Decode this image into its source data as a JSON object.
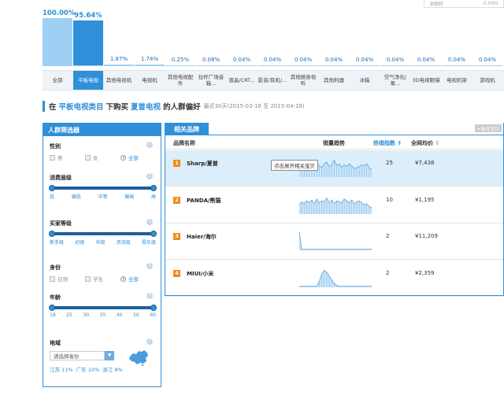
{
  "top_right": {
    "label": "油烟机",
    "value": "0.04%"
  },
  "bars": [
    {
      "pct": "100.00%",
      "ratio": 1.0,
      "active": false
    },
    {
      "pct": "95.64%",
      "ratio": 0.9564,
      "active": true
    },
    {
      "pct": "1.87%",
      "ratio": 0.0187,
      "active": false
    },
    {
      "pct": "1.74%",
      "ratio": 0.0174,
      "active": false
    },
    {
      "pct": "0.25%",
      "ratio": 0.0025,
      "active": false
    },
    {
      "pct": "0.08%",
      "ratio": 0.0008,
      "active": false
    },
    {
      "pct": "0.04%",
      "ratio": 0.0004,
      "active": false
    },
    {
      "pct": "0.04%",
      "ratio": 0.0004,
      "active": false
    },
    {
      "pct": "0.04%",
      "ratio": 0.0004,
      "active": false
    },
    {
      "pct": "0.04%",
      "ratio": 0.0004,
      "active": false
    },
    {
      "pct": "0.04%",
      "ratio": 0.0004,
      "active": false
    },
    {
      "pct": "0.04%",
      "ratio": 0.0004,
      "active": false
    },
    {
      "pct": "0.04%",
      "ratio": 0.0004,
      "active": false
    },
    {
      "pct": "0.04%",
      "ratio": 0.0004,
      "active": false
    },
    {
      "pct": "0.04%",
      "ratio": 0.0004,
      "active": false
    }
  ],
  "categories": [
    "全部",
    "平板电视",
    "其他电视机",
    "电视机",
    "其他电视配件",
    "拉杆广场音箱...",
    "液晶/CRT...",
    "影音/耳机/...",
    "其他随身视听",
    "其他利器",
    "冰箱",
    "空气净化/氧...",
    "3D电视眼镜",
    "电视机架",
    "游戏机"
  ],
  "heading": {
    "part1": "在",
    "category": "平板电视类目",
    "part2": "下购买",
    "brand": "夏普电视",
    "part3": "的人群偏好",
    "range": "最近30天(2015-03-18 至 2015-04-16)"
  },
  "filter": {
    "title": "人群筛选器",
    "gender": {
      "title": "性别",
      "options": [
        "男",
        "女",
        "全部"
      ],
      "selected": "全部"
    },
    "consumption": {
      "title": "消费层级",
      "ticks": [
        "低",
        "偏低",
        "中等",
        "偏高",
        "高"
      ]
    },
    "buyer_level": {
      "title": "买家等级",
      "ticks": [
        "新手级",
        "初级",
        "中级",
        "资深级",
        "骨灰级"
      ]
    },
    "identity": {
      "title": "身份",
      "options": [
        "白领",
        "学生",
        "全部"
      ],
      "selected": "全部"
    },
    "age": {
      "title": "年龄",
      "ticks": [
        "18",
        "25",
        "30",
        "35",
        "40",
        "50",
        "60"
      ]
    },
    "region": {
      "title": "地域",
      "placeholder": "请选择省份",
      "stats": [
        "江苏 11%",
        "广东 10%",
        "浙江 8%"
      ]
    }
  },
  "brands": {
    "tab": "相关品牌",
    "unfold": "+展开宝贝",
    "columns": {
      "name": "品牌名称",
      "trend": "销量趋势",
      "hot": "热销指数",
      "price": "全网均价"
    },
    "tooltip": "点击展开相关宝贝",
    "rows": [
      {
        "rank": "1",
        "name": "Sharp/夏普",
        "hot": "25",
        "price": "¥7,438",
        "trend": [
          0.55,
          0.6,
          0.45,
          0.7,
          0.5,
          0.65,
          0.55,
          0.75,
          0.6,
          0.5,
          0.7,
          0.8,
          0.55,
          0.65,
          0.9,
          0.6,
          0.7,
          0.5,
          0.65,
          0.55,
          0.7,
          0.6,
          0.45,
          0.5,
          0.55,
          0.65,
          0.6,
          0.7,
          0.5,
          0.4
        ]
      },
      {
        "rank": "2",
        "name": "PANDA/熊猫",
        "hot": "10",
        "price": "¥1,195",
        "trend": [
          0.5,
          0.65,
          0.55,
          0.7,
          0.6,
          0.75,
          0.55,
          0.8,
          0.6,
          0.7,
          0.65,
          0.85,
          0.6,
          0.75,
          0.55,
          0.7,
          0.65,
          0.6,
          0.8,
          0.7,
          0.6,
          0.75,
          0.55,
          0.65,
          0.7,
          0.6,
          0.5,
          0.55,
          0.4,
          0.35
        ]
      },
      {
        "rank": "3",
        "name": "Haier/海尔",
        "hot": "2",
        "price": "¥11,209",
        "trend": [
          1.0,
          0.05,
          0.05,
          0.05,
          0.05,
          0.05,
          0.05,
          0.05,
          0.05,
          0.05,
          0.05,
          0.05,
          0.05,
          0.05,
          0.05,
          0.05,
          0.05,
          0.05,
          0.05,
          0.05,
          0.05,
          0.05,
          0.05,
          0.05,
          0.05,
          0.05,
          0.05,
          0.05,
          0.05,
          0.05
        ]
      },
      {
        "rank": "4",
        "name": "MIUI/小米",
        "hot": "2",
        "price": "¥2,359",
        "trend": [
          0.05,
          0.05,
          0.05,
          0.05,
          0.05,
          0.05,
          0.05,
          0.05,
          0.3,
          0.7,
          0.9,
          0.8,
          0.6,
          0.4,
          0.2,
          0.1,
          0.05,
          0.05,
          0.05,
          0.05,
          0.05,
          0.05,
          0.05,
          0.05,
          0.05,
          0.05,
          0.05,
          0.05,
          0.05,
          0.05
        ]
      }
    ]
  },
  "colors": {
    "accent": "#2f8fd8",
    "bar_light": "#9ed0f5",
    "rank_badge": "#f08b1d",
    "highlight_row": "#dceefa"
  }
}
